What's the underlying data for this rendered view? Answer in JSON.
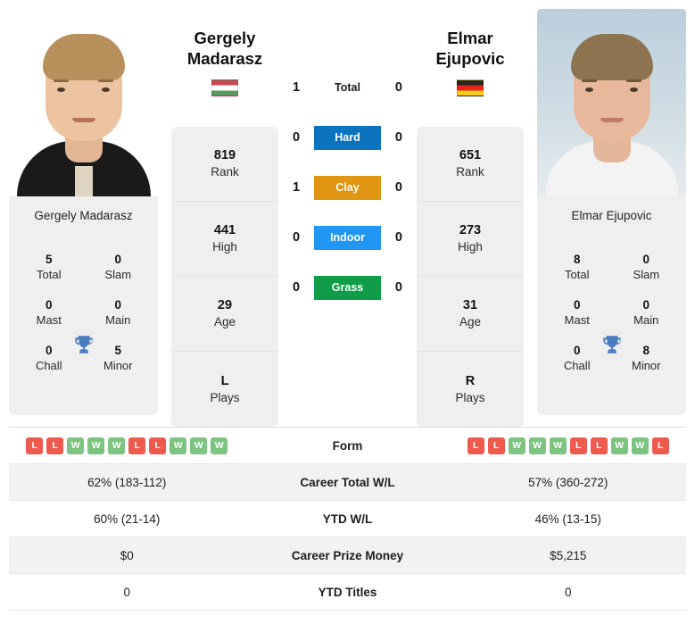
{
  "players": {
    "left": {
      "name_line1": "Gergely",
      "name_line2": "Madarasz",
      "full_name": "Gergely Madarasz",
      "flag": "hungary-flag",
      "rank": "819",
      "rank_label": "Rank",
      "high": "441",
      "high_label": "High",
      "age": "29",
      "age_label": "Age",
      "plays": "L",
      "plays_label": "Plays",
      "titles": {
        "total": "5",
        "total_label": "Total",
        "slam": "0",
        "slam_label": "Slam",
        "mast": "0",
        "mast_label": "Mast",
        "main": "0",
        "main_label": "Main",
        "chall": "0",
        "chall_label": "Chall",
        "minor": "5",
        "minor_label": "Minor"
      },
      "form": [
        "L",
        "L",
        "W",
        "W",
        "W",
        "L",
        "L",
        "W",
        "W",
        "W"
      ],
      "career_wl": "62% (183-112)",
      "ytd_wl": "60% (21-14)",
      "prize_money": "$0",
      "ytd_titles": "0"
    },
    "right": {
      "name_line1": "Elmar",
      "name_line2": "Ejupovic",
      "full_name": "Elmar Ejupovic",
      "flag": "germany-flag",
      "rank": "651",
      "rank_label": "Rank",
      "high": "273",
      "high_label": "High",
      "age": "31",
      "age_label": "Age",
      "plays": "R",
      "plays_label": "Plays",
      "titles": {
        "total": "8",
        "total_label": "Total",
        "slam": "0",
        "slam_label": "Slam",
        "mast": "0",
        "mast_label": "Mast",
        "main": "0",
        "main_label": "Main",
        "chall": "0",
        "chall_label": "Chall",
        "minor": "8",
        "minor_label": "Minor"
      },
      "form": [
        "L",
        "L",
        "W",
        "W",
        "W",
        "L",
        "L",
        "W",
        "W",
        "L"
      ],
      "career_wl": "57% (360-272)",
      "ytd_wl": "46% (13-15)",
      "prize_money": "$5,215",
      "ytd_titles": "0"
    }
  },
  "h2h": {
    "rows": [
      {
        "label": "Total",
        "left": "1",
        "right": "0",
        "color": "",
        "style": "plain"
      },
      {
        "label": "Hard",
        "left": "0",
        "right": "0",
        "color": "#0c73bf",
        "style": "badge"
      },
      {
        "label": "Clay",
        "left": "1",
        "right": "0",
        "color": "#e09612",
        "style": "badge"
      },
      {
        "label": "Indoor",
        "left": "0",
        "right": "0",
        "color": "#2196f3",
        "style": "badge"
      },
      {
        "label": "Grass",
        "left": "0",
        "right": "0",
        "color": "#0f9d48",
        "style": "badge"
      }
    ]
  },
  "table": {
    "form_label": "Form",
    "rows": [
      {
        "label": "Career Total W/L",
        "left": "62% (183-112)",
        "right": "57% (360-272)"
      },
      {
        "label": "YTD W/L",
        "left": "60% (21-14)",
        "right": "46% (13-15)"
      },
      {
        "label": "Career Prize Money",
        "left": "$0",
        "right": "$5,215"
      },
      {
        "label": "YTD Titles",
        "left": "0",
        "right": "0"
      }
    ]
  },
  "colors": {
    "win": "#7cc47f",
    "loss": "#ef5a4e",
    "panel": "#efefef",
    "row_alt": "#f2f2f2"
  }
}
